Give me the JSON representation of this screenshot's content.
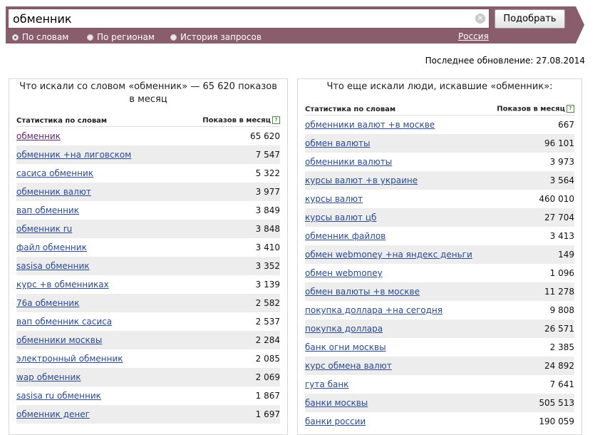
{
  "search": {
    "value": "обменник",
    "button_label": "Подобрать"
  },
  "tabs": [
    {
      "label": "По словам",
      "selected": true
    },
    {
      "label": "По регионам",
      "selected": false
    },
    {
      "label": "История запросов",
      "selected": false
    }
  ],
  "region": "Россия",
  "last_update": "Последнее обновление: 27.08.2014",
  "colors": {
    "bar": "#895d6c",
    "link": "#2a4a8f"
  },
  "left": {
    "title": "Что искали со словом «обменник» — 65 620 показов в месяц",
    "col_query": "Статистика по словам",
    "col_count": "Показов в месяц",
    "rows": [
      {
        "q": "обменник",
        "n": "65 620"
      },
      {
        "q": "обменник +на лиговском",
        "n": "7 547"
      },
      {
        "q": "сасиса обменник",
        "n": "5 322"
      },
      {
        "q": "обменник валют",
        "n": "3 977"
      },
      {
        "q": "вап обменник",
        "n": "3 849"
      },
      {
        "q": "обменник ru",
        "n": "3 848"
      },
      {
        "q": "файл обменник",
        "n": "3 410"
      },
      {
        "q": "sasisa обменник",
        "n": "3 352"
      },
      {
        "q": "курс +в обменниках",
        "n": "3 139"
      },
      {
        "q": "76а обменник",
        "n": "2 582"
      },
      {
        "q": "вап обменник сасиса",
        "n": "2 537"
      },
      {
        "q": "обменники москвы",
        "n": "2 284"
      },
      {
        "q": "электронный обменник",
        "n": "2 085"
      },
      {
        "q": "wap обменник",
        "n": "2 069"
      },
      {
        "q": "sasisa ru обменник",
        "n": "1 867"
      },
      {
        "q": "обменник денег",
        "n": "1 697"
      }
    ]
  },
  "right": {
    "title": "Что еще искали люди, искавшие «обменник»:",
    "col_query": "Статистика по словам",
    "col_count": "Показов в месяц",
    "rows": [
      {
        "q": "обменники валют +в москве",
        "n": "667"
      },
      {
        "q": "обмен валюты",
        "n": "96 101"
      },
      {
        "q": "обменники валюты",
        "n": "3 973"
      },
      {
        "q": "курсы валют +в украине",
        "n": "3 564"
      },
      {
        "q": "курсы валют",
        "n": "460 010"
      },
      {
        "q": "курсы валют цб",
        "n": "27 704"
      },
      {
        "q": "обменник файлов",
        "n": "3 413"
      },
      {
        "q": "обмен webmoney +на яндекс деньги",
        "n": "149"
      },
      {
        "q": "обмен webmoney",
        "n": "1 096"
      },
      {
        "q": "обмен валюты +в москве",
        "n": "11 278"
      },
      {
        "q": "покупка доллара +на сегодня",
        "n": "9 808"
      },
      {
        "q": "покупка доллара",
        "n": "26 571"
      },
      {
        "q": "банк огни москвы",
        "n": "2 385"
      },
      {
        "q": "курс обмена валют",
        "n": "24 892"
      },
      {
        "q": "гута банк",
        "n": "7 641"
      },
      {
        "q": "банки москвы",
        "n": "505 513"
      },
      {
        "q": "банки россии",
        "n": "190 059"
      }
    ]
  }
}
